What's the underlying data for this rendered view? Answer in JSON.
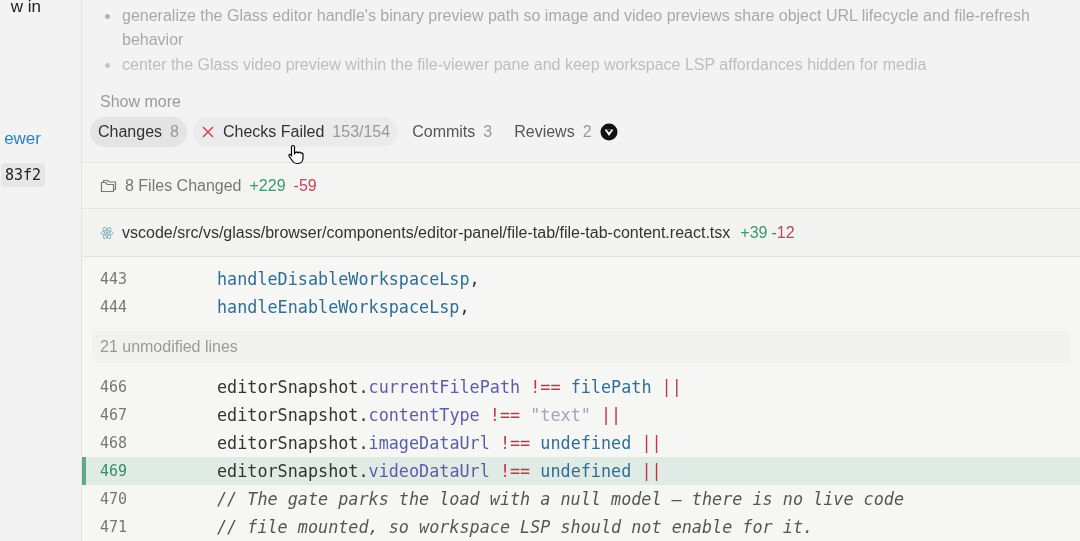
{
  "sidebar": {
    "items": [
      {
        "kind": "text",
        "text": "w in"
      },
      {
        "kind": "link",
        "text": "ewer"
      },
      {
        "kind": "code",
        "text": "83f2"
      }
    ]
  },
  "description": {
    "bullets": [
      {
        "text": "generalize the Glass editor handle's binary preview path so image and video previews share object URL lifecycle and file-refresh behavior",
        "faded": false
      },
      {
        "text": "center the Glass video preview within the file-viewer pane and keep workspace LSP affordances hidden for media",
        "faded": true
      }
    ],
    "show_more": "Show more"
  },
  "tabs": [
    {
      "label": "Changes",
      "count": "8",
      "selected": true,
      "hovered": false,
      "failed": false,
      "reviewer": false
    },
    {
      "label": "Checks Failed",
      "count": "153/154",
      "selected": false,
      "hovered": true,
      "failed": true,
      "reviewer": false
    },
    {
      "label": "Commits",
      "count": "3",
      "selected": false,
      "hovered": false,
      "failed": false,
      "reviewer": false
    },
    {
      "label": "Reviews",
      "count": "2",
      "selected": false,
      "hovered": false,
      "failed": false,
      "reviewer": true
    }
  ],
  "summary": {
    "label": "8 Files Changed",
    "additions": "+229",
    "deletions": "-59"
  },
  "file": {
    "path": "vscode/src/vs/glass/browser/components/editor-panel/file-tab/file-tab-content.react.tsx",
    "additions": "+39",
    "deletions": "-12"
  },
  "diff_rows": [
    {
      "kind": "line",
      "number": "443",
      "highlighted": false,
      "tokens": [
        {
          "text": "handleDisableWorkspaceLsp",
          "kind": "ident"
        },
        {
          "text": ",",
          "kind": "plain"
        }
      ]
    },
    {
      "kind": "line",
      "number": "444",
      "highlighted": false,
      "tokens": [
        {
          "text": "handleEnableWorkspaceLsp",
          "kind": "ident"
        },
        {
          "text": ",",
          "kind": "plain"
        }
      ]
    },
    {
      "kind": "collapsed",
      "text": "21 unmodified lines"
    },
    {
      "kind": "line",
      "number": "466",
      "highlighted": false,
      "tokens": [
        {
          "text": "editorSnapshot.",
          "kind": "plain"
        },
        {
          "text": "currentFilePath",
          "kind": "prop"
        },
        {
          "text": " !== ",
          "kind": "op"
        },
        {
          "text": "filePath",
          "kind": "ident"
        },
        {
          "text": " ||",
          "kind": "op"
        }
      ]
    },
    {
      "kind": "line",
      "number": "467",
      "highlighted": false,
      "tokens": [
        {
          "text": "editorSnapshot.",
          "kind": "plain"
        },
        {
          "text": "contentType",
          "kind": "prop"
        },
        {
          "text": " !== ",
          "kind": "op"
        },
        {
          "text": "\"text\"",
          "kind": "string"
        },
        {
          "text": " ||",
          "kind": "op"
        }
      ]
    },
    {
      "kind": "line",
      "number": "468",
      "highlighted": false,
      "tokens": [
        {
          "text": "editorSnapshot.",
          "kind": "plain"
        },
        {
          "text": "imageDataUrl",
          "kind": "prop"
        },
        {
          "text": " !== ",
          "kind": "op"
        },
        {
          "text": "undefined",
          "kind": "ident"
        },
        {
          "text": " ||",
          "kind": "op"
        }
      ]
    },
    {
      "kind": "line",
      "number": "469",
      "highlighted": true,
      "tokens": [
        {
          "text": "editorSnapshot.",
          "kind": "plain"
        },
        {
          "text": "videoDataUrl",
          "kind": "prop"
        },
        {
          "text": " !== ",
          "kind": "op"
        },
        {
          "text": "undefined",
          "kind": "ident"
        },
        {
          "text": " ||",
          "kind": "op"
        }
      ]
    },
    {
      "kind": "line",
      "number": "470",
      "highlighted": false,
      "tokens": [
        {
          "text": "// The gate parks the load with a null model — there is no live code",
          "kind": "comment"
        }
      ]
    },
    {
      "kind": "line",
      "number": "471",
      "highlighted": false,
      "tokens": [
        {
          "text": "// file mounted, so workspace LSP should not enable for it.",
          "kind": "comment"
        }
      ]
    }
  ]
}
